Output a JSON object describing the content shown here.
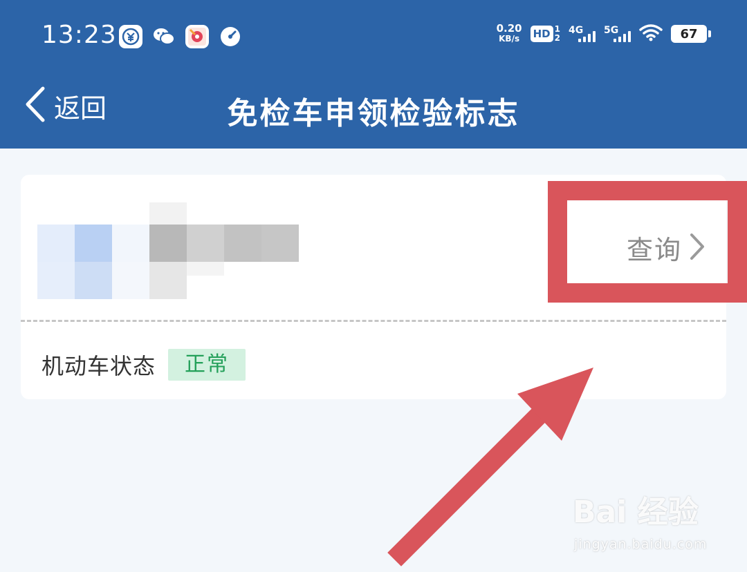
{
  "status_bar": {
    "time": "13:23",
    "apps": [
      "alipay-icon",
      "wechat-icon",
      "music-app-icon",
      "speed-meter-icon"
    ],
    "net_speed_value": "0.20",
    "net_speed_unit": "KB/s",
    "hd_label": "HD",
    "hd_sim_top": "1",
    "hd_sim_bottom": "2",
    "signal_1_label": "4G",
    "signal_2_label": "5G",
    "battery": "67"
  },
  "nav": {
    "back_label": "返回",
    "title": "免检车申领检验标志"
  },
  "vehicle_card": {
    "query_label": "查询",
    "status_label": "机动车状态",
    "status_value": "正常"
  },
  "watermark": {
    "main": "Bai 经验",
    "sub": "jingyan.baidu.com"
  },
  "colors": {
    "header_bg": "#2c64a8",
    "page_bg": "#f3f7fb",
    "annotation": "#d9555b",
    "status_badge_bg": "#d3f1e0",
    "status_badge_text": "#24a05a"
  }
}
